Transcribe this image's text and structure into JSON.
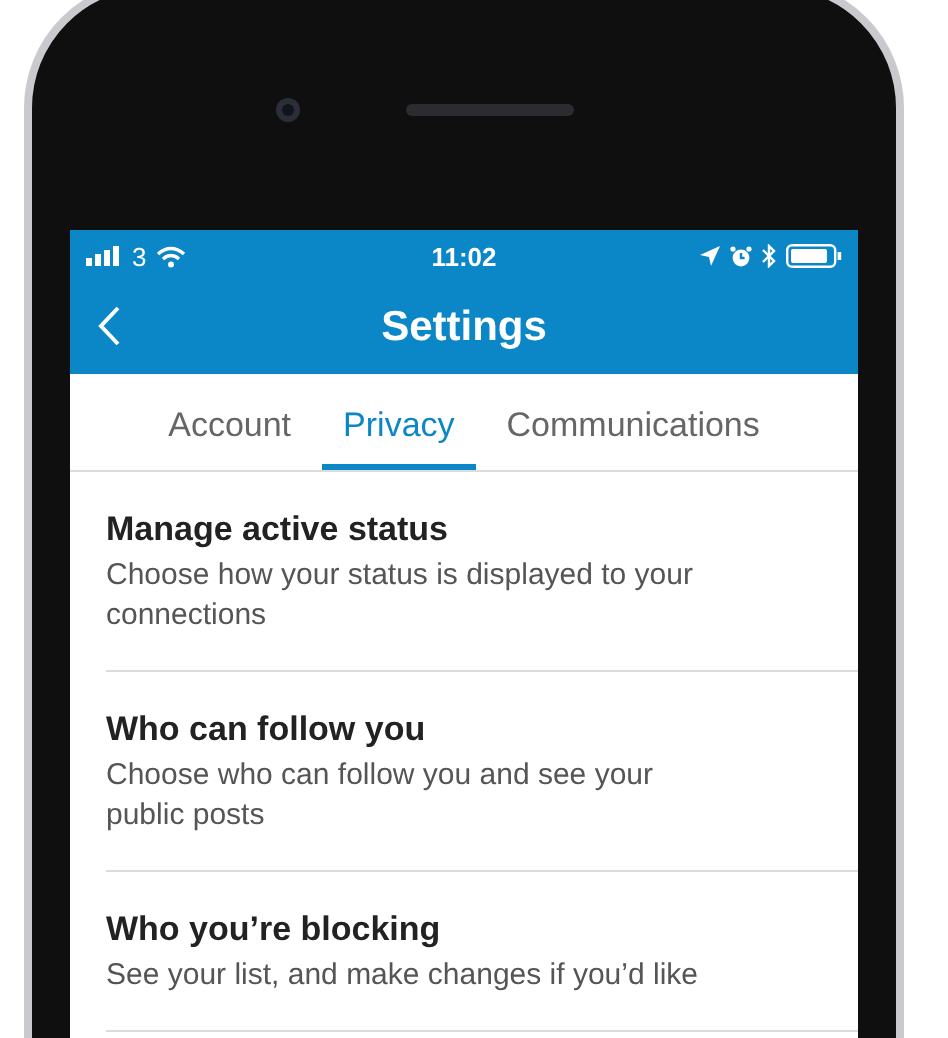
{
  "status_bar": {
    "carrier": "3",
    "time": "11:02"
  },
  "nav_bar": {
    "title": "Settings"
  },
  "tabs": [
    {
      "label": "Account",
      "selected": false
    },
    {
      "label": "Privacy",
      "selected": true
    },
    {
      "label": "Communications",
      "selected": false
    }
  ],
  "settings": [
    {
      "title": "Manage active status",
      "description": "Choose how your status is displayed to your connections"
    },
    {
      "title": "Who can follow you",
      "description": "Choose who can follow you and see your public posts"
    },
    {
      "title": "Who you’re blocking",
      "description": "See your list, and make changes if you’d like"
    }
  ]
}
